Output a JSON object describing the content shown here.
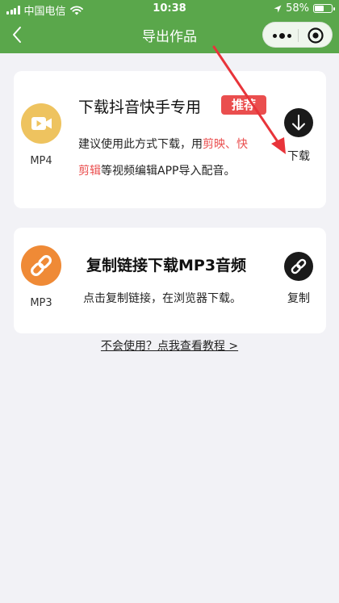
{
  "status_bar": {
    "carrier": "中国电信",
    "time": "10:38",
    "battery_percent": "58%",
    "battery_level": 0.58
  },
  "nav": {
    "title": "导出作品",
    "back_icon": "back-chevron-icon",
    "more_icon": "more-dots-icon",
    "close_icon": "target-close-icon"
  },
  "cards": [
    {
      "format_label": "MP4",
      "format_icon": "video-camera-icon",
      "icon_color": "#eec35f",
      "title": "下载抖音快手专用",
      "badge": "推荐",
      "desc_parts": [
        "建议使用此方式下载，用",
        "剪映、快",
        "剪辑",
        "等视频编辑APP导入配音。"
      ],
      "action_label": "下载",
      "action_icon": "download-arrow-icon"
    },
    {
      "format_label": "MP3",
      "format_icon": "link-icon",
      "icon_color": "#ef8a36",
      "title": "复制链接下载MP3音频",
      "desc": "点击复制链接，在浏览器下载。",
      "action_label": "复制",
      "action_icon": "link-icon"
    }
  ],
  "help_link": "不会使用？点我查看教程 >",
  "colors": {
    "header": "#5aa74b",
    "accent_red": "#ea4e4e",
    "annotation_arrow": "#e8343a"
  }
}
